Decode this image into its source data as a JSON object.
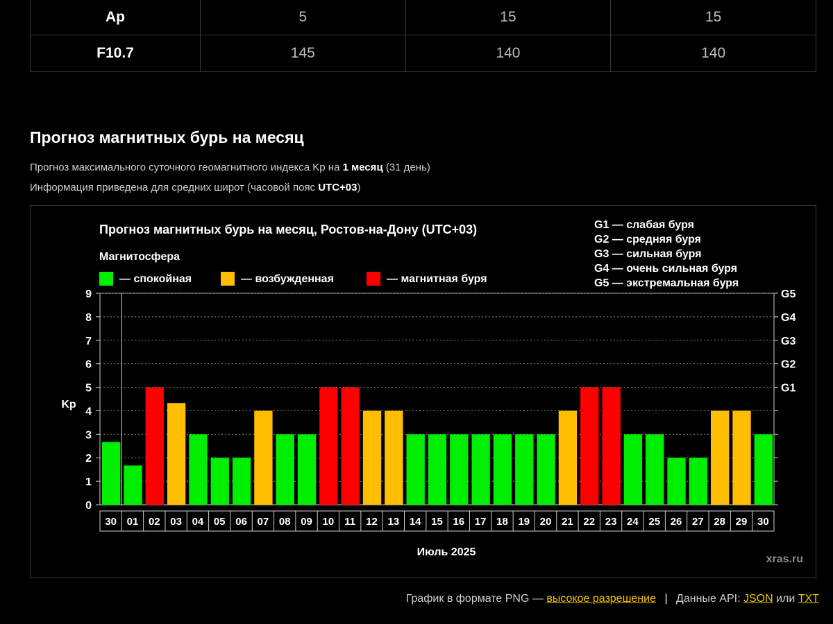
{
  "table": {
    "rows": [
      {
        "label": "Ap",
        "values": [
          "5",
          "15",
          "15"
        ]
      },
      {
        "label": "F10.7",
        "values": [
          "145",
          "140",
          "140"
        ]
      }
    ]
  },
  "section": {
    "title": "Прогноз магнитных бурь на месяц",
    "desc1_pre": "Прогноз максимального суточного геомагнитного индекса Kp на ",
    "desc1_bold": "1 месяц",
    "desc1_post": " (31 день)",
    "desc2_pre": "Информация приведена для средних широт (часовой пояс ",
    "desc2_bold": "UTC+03",
    "desc2_post": ")"
  },
  "chart_data": {
    "type": "bar",
    "title": "Прогноз магнитных бурь на месяц, Ростов-на-Дону (UTC+03)",
    "legend_title": "Магнитосфера",
    "legend": [
      {
        "label": "— спокойная",
        "color": "#00ee00"
      },
      {
        "label": "— возбужденная",
        "color": "#ffbf00"
      },
      {
        "label": "— магнитная буря",
        "color": "#ff0000"
      }
    ],
    "storm_scale": [
      "G1 — слабая буря",
      "G2 — средняя буря",
      "G3 — сильная буря",
      "G4 — очень сильная буря",
      "G5 — экстремальная буря"
    ],
    "ylabel": "Kp",
    "xlabel": "Июль 2025",
    "ylim": [
      0,
      9
    ],
    "yticks": [
      "0",
      "1",
      "2",
      "3",
      "4",
      "5",
      "6",
      "7",
      "8",
      "9"
    ],
    "right_ticks": [
      {
        "value": 5,
        "label": "G1"
      },
      {
        "value": 6,
        "label": "G2"
      },
      {
        "value": 7,
        "label": "G3"
      },
      {
        "value": 8,
        "label": "G4"
      },
      {
        "value": 9,
        "label": "G5"
      }
    ],
    "categories": [
      "30",
      "01",
      "02",
      "03",
      "04",
      "05",
      "06",
      "07",
      "08",
      "09",
      "10",
      "11",
      "12",
      "13",
      "14",
      "15",
      "16",
      "17",
      "18",
      "19",
      "20",
      "21",
      "22",
      "23",
      "24",
      "25",
      "26",
      "27",
      "28",
      "29",
      "30"
    ],
    "values": [
      2.67,
      1.67,
      5,
      4.33,
      3,
      2,
      2,
      4,
      3,
      3,
      5,
      5,
      4,
      4,
      3,
      3,
      3,
      3,
      3,
      3,
      3,
      4,
      5,
      5,
      3,
      3,
      2,
      2,
      4,
      4,
      3
    ],
    "level": [
      "quiet",
      "quiet",
      "storm",
      "active",
      "quiet",
      "quiet",
      "quiet",
      "active",
      "quiet",
      "quiet",
      "storm",
      "storm",
      "active",
      "active",
      "quiet",
      "quiet",
      "quiet",
      "quiet",
      "quiet",
      "quiet",
      "quiet",
      "active",
      "storm",
      "storm",
      "quiet",
      "quiet",
      "quiet",
      "quiet",
      "active",
      "active",
      "quiet"
    ],
    "colors": {
      "quiet": "#00ee00",
      "active": "#ffbf00",
      "storm": "#ff0000"
    },
    "grid": true,
    "watermark": "xras.ru"
  },
  "footer": {
    "text": "График в формате PNG —",
    "hires_link": "высокое разрешение",
    "sep": "|",
    "api_text": "Данные API:",
    "json_link": "JSON",
    "or": "или",
    "txt_link": "TXT"
  }
}
